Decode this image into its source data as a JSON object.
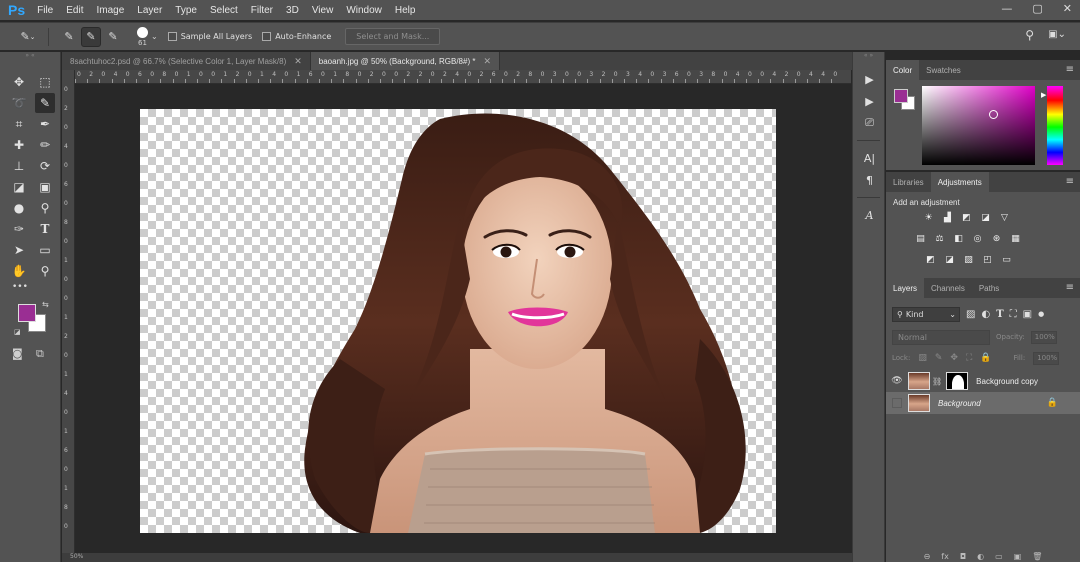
{
  "app": {
    "logo": "Ps",
    "menu": [
      "File",
      "Edit",
      "Image",
      "Layer",
      "Type",
      "Select",
      "Filter",
      "3D",
      "View",
      "Window",
      "Help"
    ],
    "window_controls": [
      "—",
      "▢",
      "✕"
    ]
  },
  "options_bar": {
    "brush_size": "61",
    "sample_all_layers": "Sample All Layers",
    "auto_enhance": "Auto-Enhance",
    "select_and_mask": "Select and Mask..."
  },
  "tabs": [
    {
      "label": "8sachtuhoc2.psd @ 66.7% (Selective Color 1, Layer Mask/8)",
      "close": "✕"
    },
    {
      "label": "baoanh.jpg @ 50% (Background, RGB/8#) *",
      "close": "✕"
    }
  ],
  "ruler": {
    "h_labels": [
      "0",
      "2",
      "0",
      "4",
      "0",
      "6",
      "0",
      "8",
      "0",
      "1",
      "0",
      "0",
      "1",
      "2",
      "0",
      "1",
      "4",
      "0",
      "1",
      "6",
      "0",
      "1",
      "8",
      "0",
      "2",
      "0",
      "0",
      "2",
      "2",
      "0",
      "2",
      "4",
      "0",
      "2",
      "6",
      "0",
      "2",
      "8",
      "0",
      "3",
      "0",
      "0",
      "3",
      "2",
      "0",
      "3",
      "4",
      "0",
      "3",
      "6",
      "0",
      "3",
      "8",
      "0",
      "4",
      "0",
      "0",
      "4",
      "2",
      "0",
      "4",
      "4",
      "0"
    ],
    "v_labels": [
      "0",
      "2",
      "0",
      "4",
      "0",
      "6",
      "0",
      "8",
      "0",
      "1",
      "0",
      "0",
      "1",
      "2",
      "0",
      "1",
      "4",
      "0",
      "1",
      "6",
      "0",
      "1",
      "8",
      "0"
    ]
  },
  "tools": {
    "icons": [
      "move-icon",
      "marquee-icon",
      "lasso-icon",
      "quick-selection-icon",
      "crop-icon",
      "eyedropper-icon",
      "healing-icon",
      "brush-icon",
      "stamp-icon",
      "history-brush-icon",
      "eraser-icon",
      "gradient-icon",
      "blur-icon",
      "dodge-icon",
      "pen-icon",
      "type-icon",
      "path-select-icon",
      "shape-icon",
      "hand-icon",
      "zoom-icon"
    ],
    "glyphs": [
      "✥",
      "⬚",
      "➰",
      "✎",
      "⌗",
      "✒",
      "✚",
      "✏",
      "⊥",
      "⟳",
      "◪",
      "▣",
      "●",
      "⚲",
      "✑",
      "T",
      "➤",
      "▭",
      "✋",
      "🔍"
    ],
    "more": "•••",
    "foreground_color": "#9a2e93",
    "background_color": "#ffffff"
  },
  "side_strip": [
    "▶",
    "▶",
    "⎚",
    "A|",
    "¶",
    "A"
  ],
  "color_panel": {
    "tabs": [
      "Color",
      "Swatches"
    ],
    "foreground_color": "#9a2e93"
  },
  "adjustments_panel": {
    "tabs": [
      "Libraries",
      "Adjustments"
    ],
    "title": "Add an adjustment",
    "row1": [
      "☀",
      "▟",
      "◩",
      "◪",
      "▽"
    ],
    "row2": [
      "▤",
      "⚖",
      "◧",
      "◎",
      "⊛",
      "▦"
    ],
    "row3": [
      "◩",
      "◪",
      "▨",
      "◰",
      "▭"
    ]
  },
  "layers_panel": {
    "tabs": [
      "Layers",
      "Channels",
      "Paths"
    ],
    "kind": "Kind",
    "blend_mode": "Normal",
    "opacity_label": "Opacity:",
    "opacity_value": "100%",
    "lock_label": "Lock:",
    "fill_label": "Fill:",
    "fill_value": "100%",
    "layers": [
      {
        "name": "Background copy",
        "visible": true,
        "has_mask": true
      },
      {
        "name": "Background",
        "visible": false,
        "locked": true
      }
    ],
    "footer": [
      "⊖",
      "fx",
      "◘",
      "◐",
      "▭",
      "▣",
      "🗑"
    ]
  },
  "status": "50%"
}
